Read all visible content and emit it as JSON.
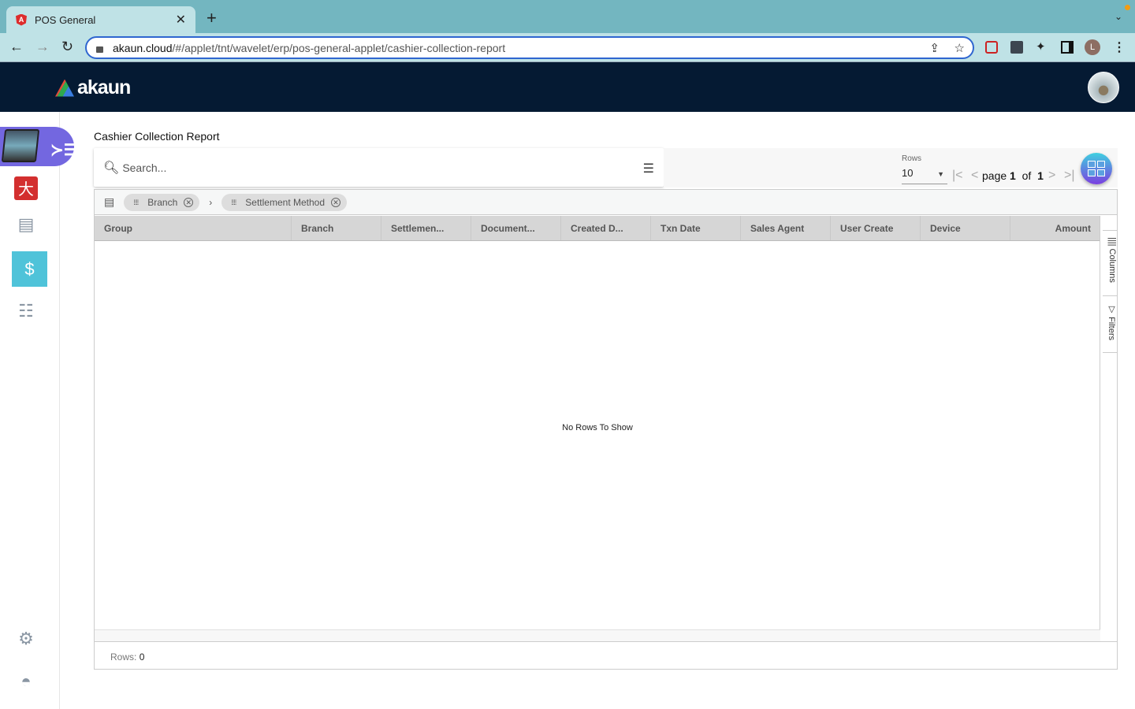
{
  "browser": {
    "tab_title": "POS General",
    "url_host": "akaun.cloud",
    "url_path": "/#/applet/tnt/wavelet/erp/pos-general-applet/cashier-collection-report",
    "profile_initial": "L"
  },
  "app": {
    "logo_text": "akaun"
  },
  "page": {
    "title": "Cashier Collection Report",
    "search_placeholder": "Search..."
  },
  "pager": {
    "rows_label": "Rows",
    "rows_value": "10",
    "page_word": "page",
    "page": "1",
    "of_word": "of",
    "total": "1"
  },
  "group_chips": [
    "Branch",
    "Settlement Method"
  ],
  "columns": [
    "Group",
    "Branch",
    "Settlemen...",
    "Document...",
    "Created D...",
    "Txn Date",
    "Sales Agent",
    "User Create",
    "Device",
    "Amount"
  ],
  "side_panel": {
    "columns": "Columns",
    "filters": "Filters"
  },
  "grid": {
    "empty_text": "No Rows To Show",
    "rows_label": "Rows:",
    "rows_count": "0"
  },
  "colors": {
    "appbar": "#051a33",
    "accent": "#7367e0",
    "active_item": "#4fc3d9"
  }
}
